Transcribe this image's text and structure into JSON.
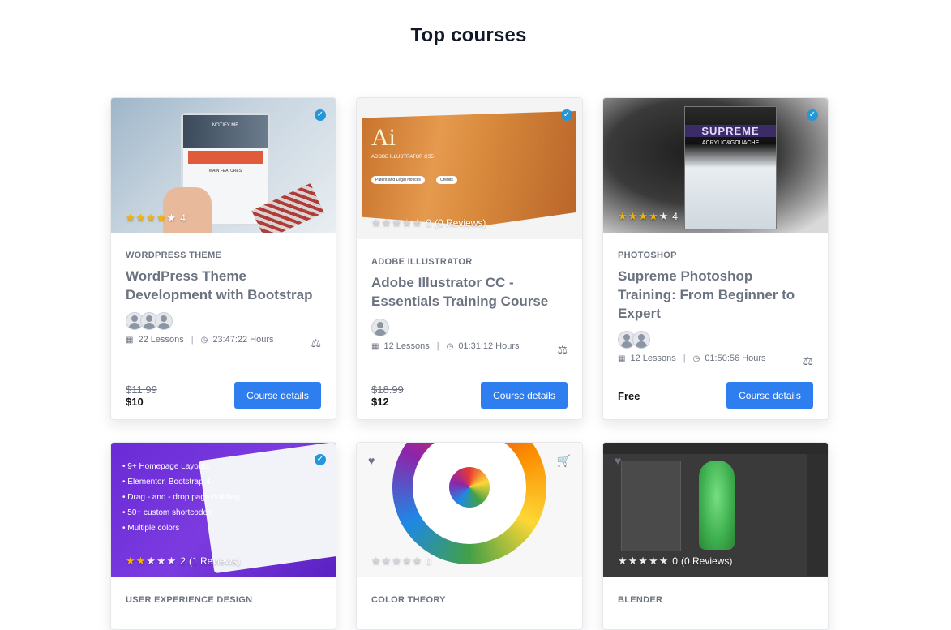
{
  "section_title": "Top courses",
  "cards": [
    {
      "category": "WordPress Theme",
      "title": "WordPress Theme Development with Bootstrap",
      "rating_value": "4",
      "stars_filled": 4,
      "lessons": "22 Lessons",
      "duration": "23:47:22 Hours",
      "old_price": "$11.99",
      "price": "$10",
      "button": "Course details",
      "instructors": 3,
      "image_text": "NOTIFY ME",
      "image_text2": "MAIN FEATURES"
    },
    {
      "category": "Adobe Illustrator",
      "title": "Adobe Illustrator CC - Essentials Training Course",
      "rating_value": "0",
      "reviews": "(0 Reviews)",
      "stars_filled": 0,
      "lessons": "12 Lessons",
      "duration": "01:31:12 Hours",
      "old_price": "$18.99",
      "price": "$12",
      "button": "Course details",
      "instructors": 1,
      "image_logo": "Ai",
      "image_product": "ADOBE ILLUSTRATOR CS5",
      "image_btn1": "Patent and Legal Notices",
      "image_btn2": "Credits"
    },
    {
      "category": "Photoshop",
      "title": "Supreme Photoshop Training: From Beginner to Expert",
      "rating_value": "4",
      "stars_filled": 4,
      "lessons": "12 Lessons",
      "duration": "01:50:56 Hours",
      "price_free": "Free",
      "button": "Course details",
      "instructors": 2,
      "image_title": "SUPREME",
      "image_sub": "ACRYLIC&GOUACHE"
    },
    {
      "category": "User Experience Design",
      "rating_value": "2",
      "reviews": "(1 Reviews)",
      "stars_filled": 2,
      "image_lines": [
        "9+ Homepage Layouts",
        "Elementor, Bootstrap 4.",
        "Drag - and - drop page building",
        "50+ custom shortcodes",
        "Multiple colors"
      ]
    },
    {
      "category": "Color Theory",
      "rating_value": "0",
      "stars_filled": 0
    },
    {
      "category": "Blender",
      "rating_value": "0",
      "reviews": "(0 Reviews)",
      "stars_filled": 0
    }
  ],
  "colors": {
    "button": "#2f7ef0",
    "star": "#f5b301",
    "check": "#2596d8"
  }
}
